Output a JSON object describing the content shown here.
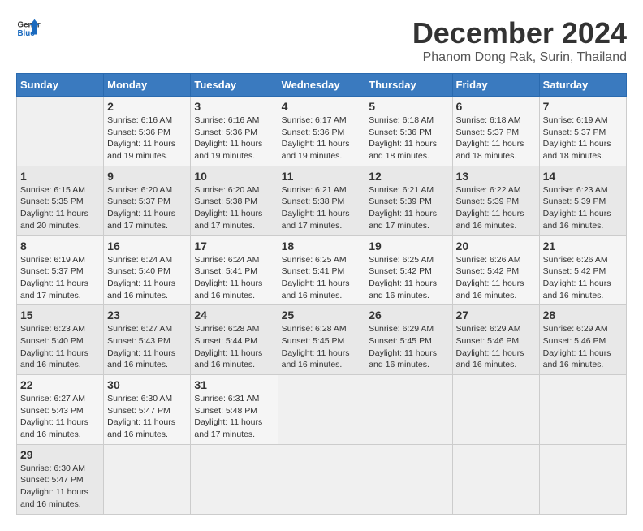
{
  "header": {
    "logo_general": "General",
    "logo_blue": "Blue",
    "title": "December 2024",
    "subtitle": "Phanom Dong Rak, Surin, Thailand"
  },
  "calendar": {
    "days_of_week": [
      "Sunday",
      "Monday",
      "Tuesday",
      "Wednesday",
      "Thursday",
      "Friday",
      "Saturday"
    ],
    "weeks": [
      [
        {
          "day": "",
          "detail": ""
        },
        {
          "day": "2",
          "detail": "Sunrise: 6:16 AM\nSunset: 5:36 PM\nDaylight: 11 hours\nand 19 minutes."
        },
        {
          "day": "3",
          "detail": "Sunrise: 6:16 AM\nSunset: 5:36 PM\nDaylight: 11 hours\nand 19 minutes."
        },
        {
          "day": "4",
          "detail": "Sunrise: 6:17 AM\nSunset: 5:36 PM\nDaylight: 11 hours\nand 19 minutes."
        },
        {
          "day": "5",
          "detail": "Sunrise: 6:18 AM\nSunset: 5:36 PM\nDaylight: 11 hours\nand 18 minutes."
        },
        {
          "day": "6",
          "detail": "Sunrise: 6:18 AM\nSunset: 5:37 PM\nDaylight: 11 hours\nand 18 minutes."
        },
        {
          "day": "7",
          "detail": "Sunrise: 6:19 AM\nSunset: 5:37 PM\nDaylight: 11 hours\nand 18 minutes."
        }
      ],
      [
        {
          "day": "1",
          "detail": "Sunrise: 6:15 AM\nSunset: 5:35 PM\nDaylight: 11 hours\nand 20 minutes."
        },
        {
          "day": "9",
          "detail": "Sunrise: 6:20 AM\nSunset: 5:37 PM\nDaylight: 11 hours\nand 17 minutes."
        },
        {
          "day": "10",
          "detail": "Sunrise: 6:20 AM\nSunset: 5:38 PM\nDaylight: 11 hours\nand 17 minutes."
        },
        {
          "day": "11",
          "detail": "Sunrise: 6:21 AM\nSunset: 5:38 PM\nDaylight: 11 hours\nand 17 minutes."
        },
        {
          "day": "12",
          "detail": "Sunrise: 6:21 AM\nSunset: 5:39 PM\nDaylight: 11 hours\nand 17 minutes."
        },
        {
          "day": "13",
          "detail": "Sunrise: 6:22 AM\nSunset: 5:39 PM\nDaylight: 11 hours\nand 16 minutes."
        },
        {
          "day": "14",
          "detail": "Sunrise: 6:23 AM\nSunset: 5:39 PM\nDaylight: 11 hours\nand 16 minutes."
        }
      ],
      [
        {
          "day": "8",
          "detail": "Sunrise: 6:19 AM\nSunset: 5:37 PM\nDaylight: 11 hours\nand 17 minutes."
        },
        {
          "day": "16",
          "detail": "Sunrise: 6:24 AM\nSunset: 5:40 PM\nDaylight: 11 hours\nand 16 minutes."
        },
        {
          "day": "17",
          "detail": "Sunrise: 6:24 AM\nSunset: 5:41 PM\nDaylight: 11 hours\nand 16 minutes."
        },
        {
          "day": "18",
          "detail": "Sunrise: 6:25 AM\nSunset: 5:41 PM\nDaylight: 11 hours\nand 16 minutes."
        },
        {
          "day": "19",
          "detail": "Sunrise: 6:25 AM\nSunset: 5:42 PM\nDaylight: 11 hours\nand 16 minutes."
        },
        {
          "day": "20",
          "detail": "Sunrise: 6:26 AM\nSunset: 5:42 PM\nDaylight: 11 hours\nand 16 minutes."
        },
        {
          "day": "21",
          "detail": "Sunrise: 6:26 AM\nSunset: 5:42 PM\nDaylight: 11 hours\nand 16 minutes."
        }
      ],
      [
        {
          "day": "15",
          "detail": "Sunrise: 6:23 AM\nSunset: 5:40 PM\nDaylight: 11 hours\nand 16 minutes."
        },
        {
          "day": "23",
          "detail": "Sunrise: 6:27 AM\nSunset: 5:43 PM\nDaylight: 11 hours\nand 16 minutes."
        },
        {
          "day": "24",
          "detail": "Sunrise: 6:28 AM\nSunset: 5:44 PM\nDaylight: 11 hours\nand 16 minutes."
        },
        {
          "day": "25",
          "detail": "Sunrise: 6:28 AM\nSunset: 5:45 PM\nDaylight: 11 hours\nand 16 minutes."
        },
        {
          "day": "26",
          "detail": "Sunrise: 6:29 AM\nSunset: 5:45 PM\nDaylight: 11 hours\nand 16 minutes."
        },
        {
          "day": "27",
          "detail": "Sunrise: 6:29 AM\nSunset: 5:46 PM\nDaylight: 11 hours\nand 16 minutes."
        },
        {
          "day": "28",
          "detail": "Sunrise: 6:29 AM\nSunset: 5:46 PM\nDaylight: 11 hours\nand 16 minutes."
        }
      ],
      [
        {
          "day": "22",
          "detail": "Sunrise: 6:27 AM\nSunset: 5:43 PM\nDaylight: 11 hours\nand 16 minutes."
        },
        {
          "day": "30",
          "detail": "Sunrise: 6:30 AM\nSunset: 5:47 PM\nDaylight: 11 hours\nand 16 minutes."
        },
        {
          "day": "31",
          "detail": "Sunrise: 6:31 AM\nSunset: 5:48 PM\nDaylight: 11 hours\nand 17 minutes."
        },
        {
          "day": "",
          "detail": ""
        },
        {
          "day": "",
          "detail": ""
        },
        {
          "day": "",
          "detail": ""
        },
        {
          "day": "",
          "detail": ""
        }
      ],
      [
        {
          "day": "29",
          "detail": "Sunrise: 6:30 AM\nSunset: 5:47 PM\nDaylight: 11 hours\nand 16 minutes."
        },
        {
          "day": "",
          "detail": ""
        },
        {
          "day": "",
          "detail": ""
        },
        {
          "day": "",
          "detail": ""
        },
        {
          "day": "",
          "detail": ""
        },
        {
          "day": "",
          "detail": ""
        },
        {
          "day": "",
          "detail": ""
        }
      ]
    ]
  }
}
